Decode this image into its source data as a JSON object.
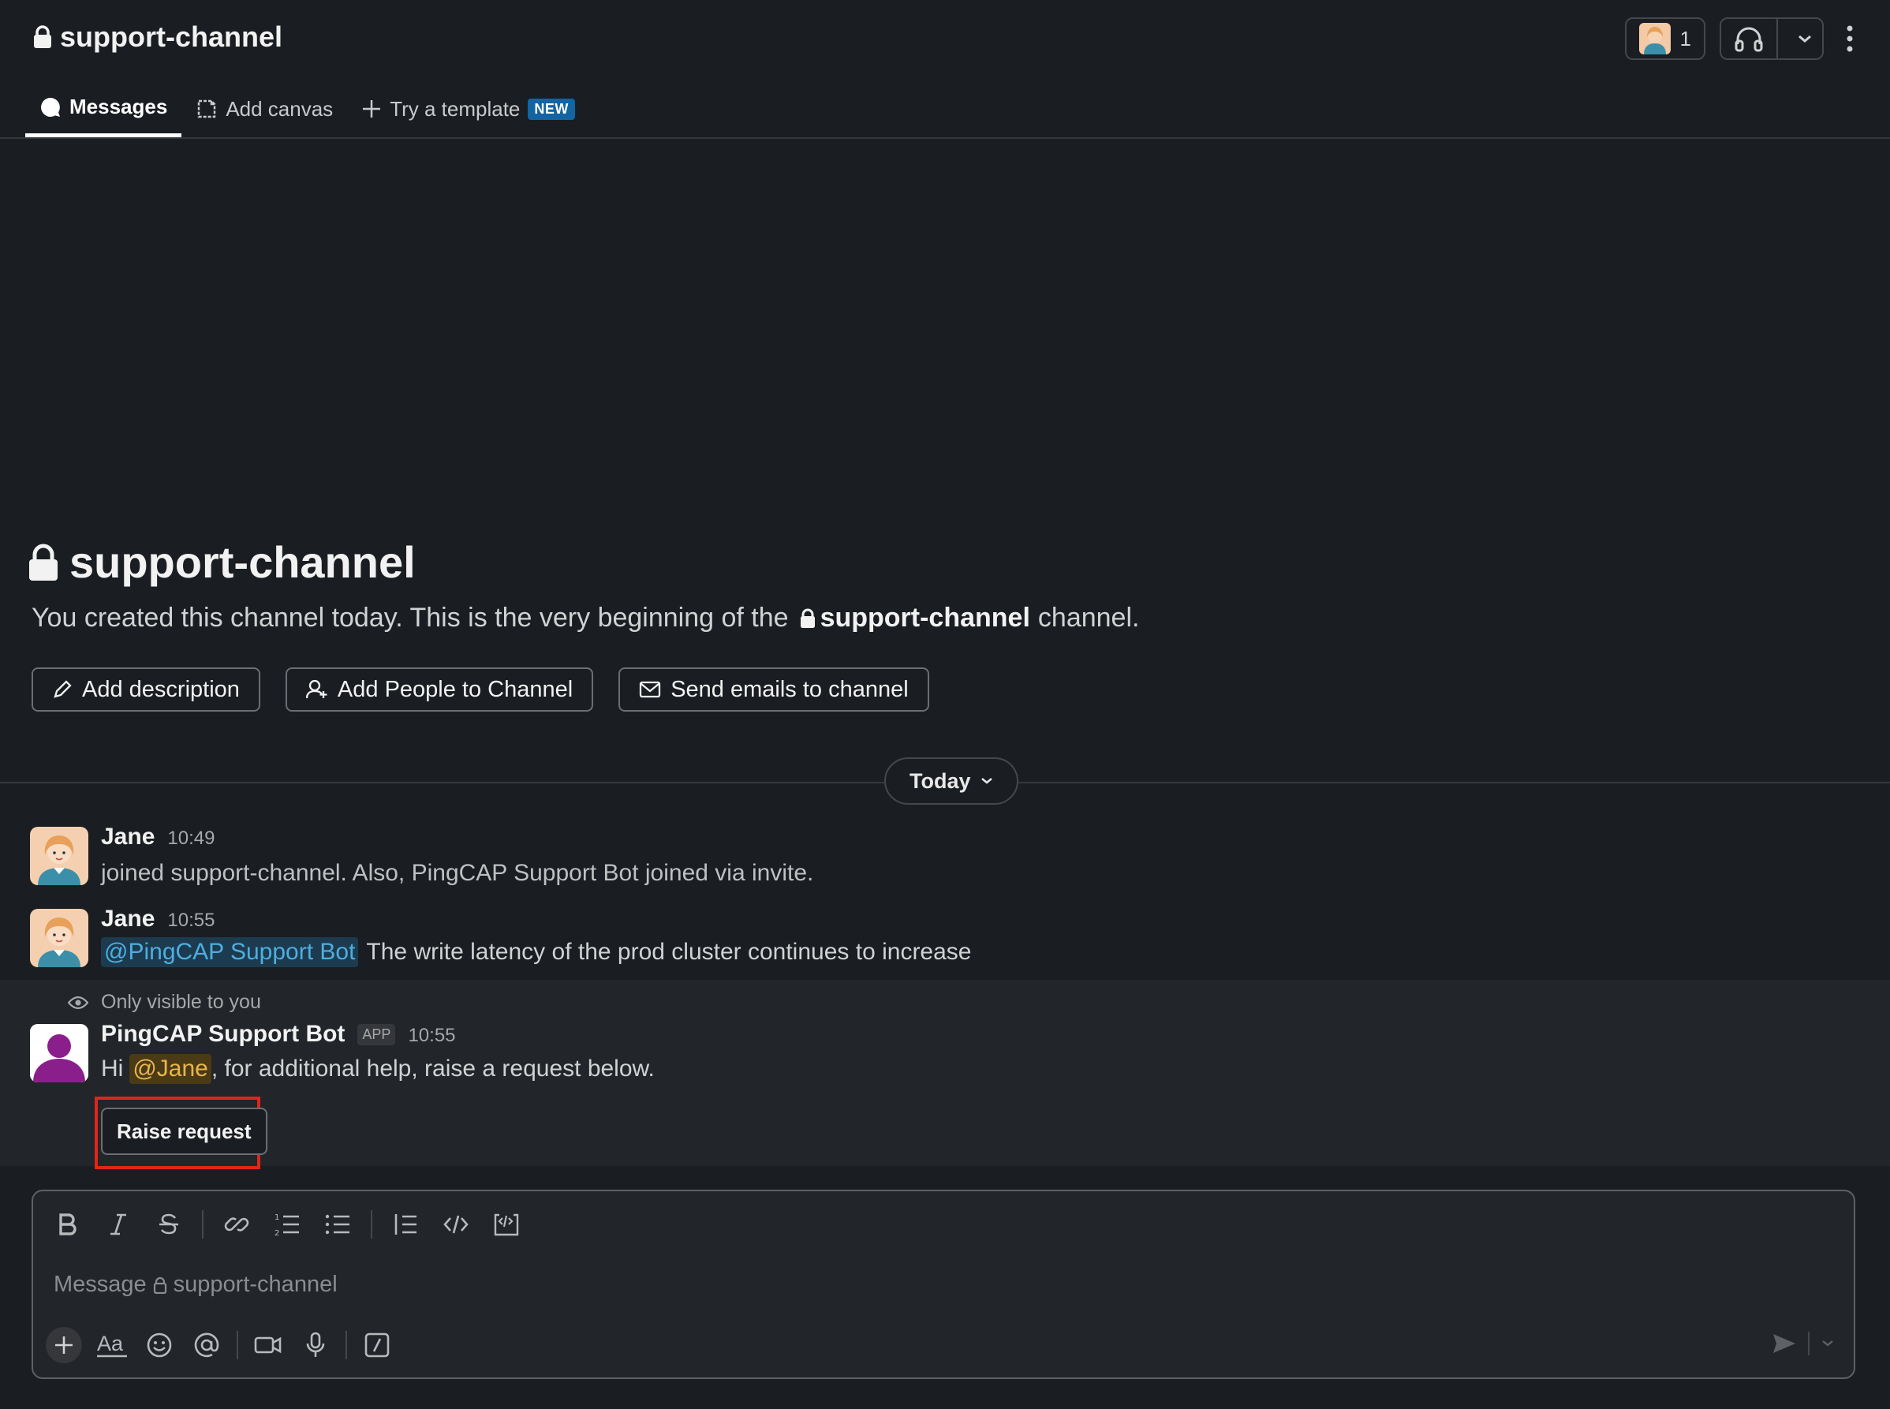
{
  "header": {
    "channel_name": "support-channel",
    "member_count": "1",
    "tabs": [
      {
        "label": "Messages"
      },
      {
        "label": "Add canvas"
      },
      {
        "label": "Try a template",
        "badge": "NEW"
      }
    ]
  },
  "intro": {
    "title": "support-channel",
    "text_before": "You created this channel today. This is the very beginning of the",
    "channel_name": "support-channel",
    "text_after": "channel.",
    "actions": [
      {
        "label": "Add description"
      },
      {
        "label": "Add People to Channel"
      },
      {
        "label": "Send emails to channel"
      }
    ]
  },
  "divider": {
    "label": "Today"
  },
  "messages": [
    {
      "author": "Jane",
      "time": "10:49",
      "text": "joined support-channel. Also, PingCAP Support Bot joined via invite."
    },
    {
      "author": "Jane",
      "time": "10:55",
      "mention": "@PingCAP Support Bot",
      "text": "The write latency of the prod cluster continues to increase"
    },
    {
      "visibility_note": "Only visible to you",
      "author": "PingCAP Support Bot",
      "badge": "APP",
      "time": "10:55",
      "text_before": "Hi",
      "mention": "@Jane",
      "text_after": ", for additional help, raise a request below.",
      "button_label": "Raise request"
    }
  ],
  "composer": {
    "placeholder_prefix": "Message",
    "placeholder_channel": "support-channel"
  },
  "colors": {
    "background": "#1a1d21",
    "mention_blue": "#4eaee0",
    "mention_yellow": "#e8b54d",
    "new_badge": "#1264a3",
    "highlight_box": "#e0251b"
  }
}
